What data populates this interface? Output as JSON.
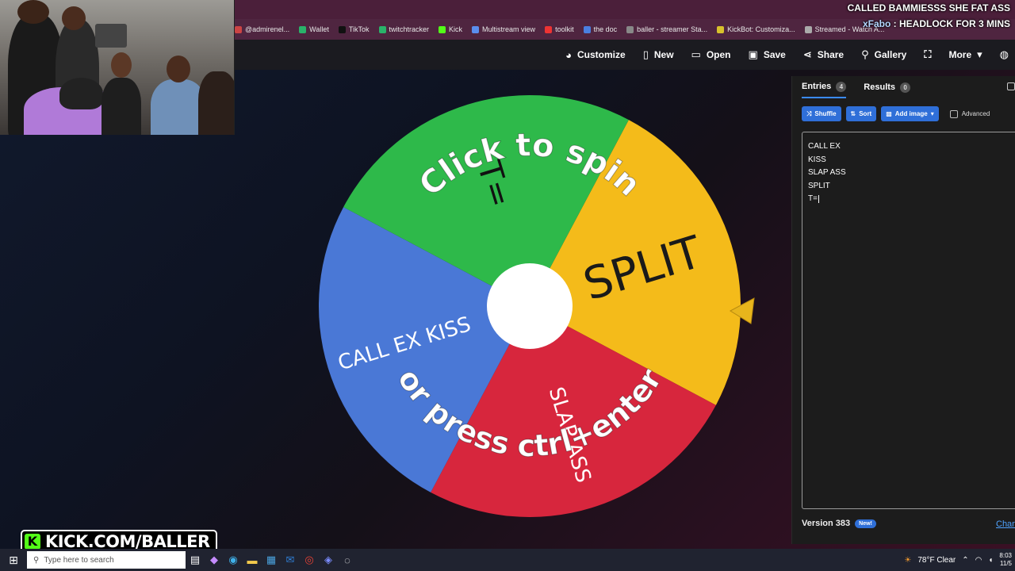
{
  "overlay": {
    "line1": "CALLED BAMMIESSS SHE FAT ASS",
    "line2_user": "xFabo",
    "line2_text": ": HEADLOCK FOR 3 MINS"
  },
  "bookmarks": [
    {
      "label": "@admirenel...",
      "color": "#c44"
    },
    {
      "label": "Wallet",
      "color": "#2ab26a"
    },
    {
      "label": "TikTok",
      "color": "#111"
    },
    {
      "label": "twitchtracker",
      "color": "#2ab26a"
    },
    {
      "label": "Kick",
      "color": "#53fc18"
    },
    {
      "label": "Multistream view",
      "color": "#5a8dee"
    },
    {
      "label": "toolkit",
      "color": "#e33"
    },
    {
      "label": "the doc",
      "color": "#4a7fe0"
    },
    {
      "label": "baller - streamer Sta...",
      "color": "#888"
    },
    {
      "label": "KickBot: Customiza...",
      "color": "#d8c12c"
    },
    {
      "label": "Streamed - Watch A...",
      "color": "#aaa"
    }
  ],
  "nav": {
    "customize": "Customize",
    "new": "New",
    "open": "Open",
    "save": "Save",
    "share": "Share",
    "gallery": "Gallery",
    "more": "More"
  },
  "wheel": {
    "segments": [
      {
        "label": "SPLIT",
        "color": "#f4bb1a"
      },
      {
        "label": "SLAP ASS",
        "color": "#d7263d"
      },
      {
        "label": "CALL EX KISS",
        "color": "#4a78d6"
      },
      {
        "label": "T=",
        "color": "#2eb94a"
      }
    ],
    "spin_text_top": "Click to spin",
    "spin_text_bottom": "or press ctrl+enter"
  },
  "sidebar": {
    "tab_entries": "Entries",
    "entries_count": "4",
    "tab_results": "Results",
    "results_count": "0",
    "shuffle": "Shuffle",
    "sort": "Sort",
    "add_image": "Add image",
    "advanced": "Advanced",
    "entries": [
      "CALL EX",
      "KISS",
      "SLAP ASS",
      "SPLIT",
      "T="
    ],
    "version": "Version 383",
    "new_badge": "New!",
    "changelog": "Chan"
  },
  "kick_banner": "KICK.COM/BALLER",
  "taskbar": {
    "search_placeholder": "Type here to search",
    "weather": "78°F  Clear",
    "time": "8:03",
    "date": "11/5"
  }
}
